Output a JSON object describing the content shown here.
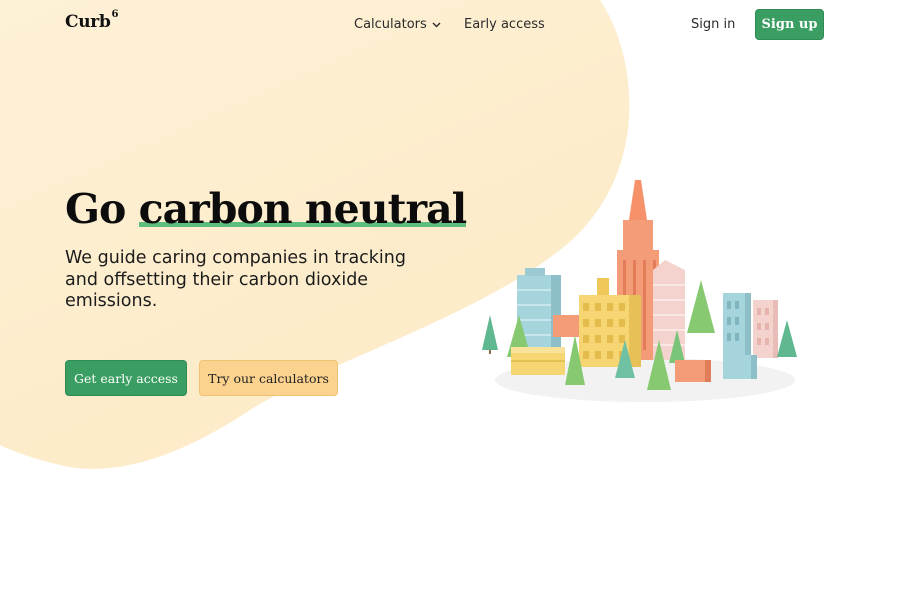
{
  "brand": {
    "name": "Curb",
    "superscript": "6"
  },
  "nav": {
    "calculators_label": "Calculators",
    "early_access_label": "Early access",
    "sign_in_label": "Sign in",
    "sign_up_label": "Sign up"
  },
  "hero": {
    "headline_prefix": "Go ",
    "headline_highlight": "carbon neutral",
    "subheadline": "We guide caring companies in tracking and offsetting their carbon dioxide emissions.",
    "primary_cta": "Get early access",
    "secondary_cta": "Try our calculators"
  },
  "colors": {
    "accent_green": "#3a9e63",
    "highlight_green": "#5cbd7f",
    "cta_yellow": "#fcd38e",
    "blob_cream": "#fef1d4"
  },
  "icons": {
    "calculators_dropdown": "chevron-down-icon",
    "illustration": "isometric-city-illustration"
  }
}
